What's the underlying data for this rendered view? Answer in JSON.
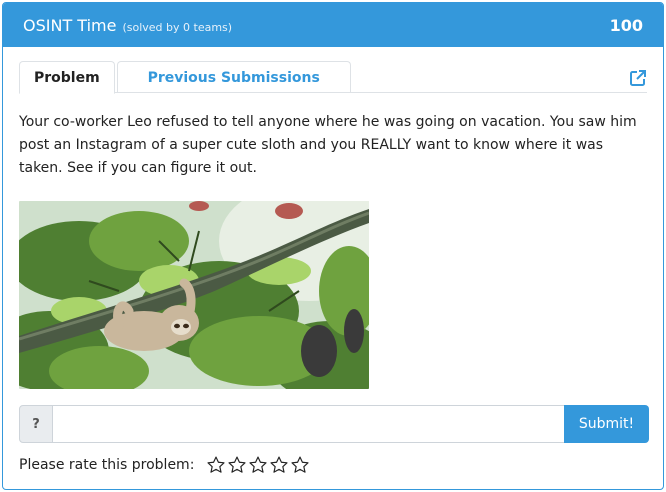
{
  "challenge": {
    "title": "OSINT Time",
    "solved_note": "(solved by 0 teams)",
    "points": "100"
  },
  "tabs": {
    "problem_label": "Problem",
    "submissions_label": "Previous Submissions"
  },
  "description": "Your co-worker Leo refused to tell anyone where he was going on vacation. You saw him post an Instagram of a super cute sloth and you REALLY want to know where it was taken. See if you can figure it out.",
  "answer": {
    "addon_label": "?",
    "value": "",
    "placeholder": "",
    "submit_label": "Submit!"
  },
  "rating": {
    "label": "Please rate this problem:",
    "stars": 0,
    "max": 5
  },
  "icons": {
    "external": "external-link-icon",
    "star": "star-outline-icon"
  },
  "colors": {
    "accent": "#3498db",
    "header_text": "#ffffff"
  }
}
